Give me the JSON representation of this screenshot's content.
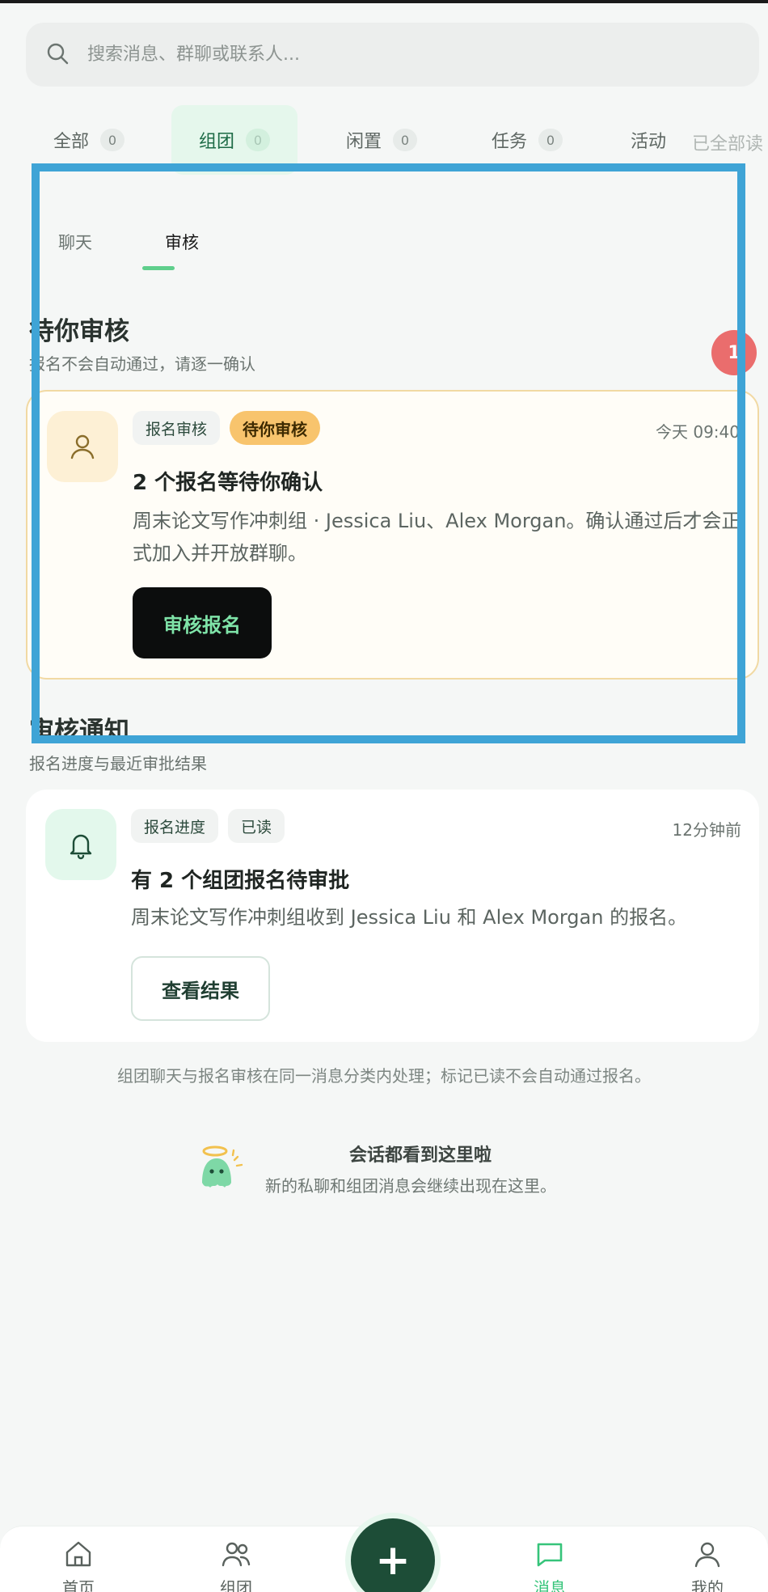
{
  "search": {
    "placeholder": "搜索消息、群聊或联系人..."
  },
  "category_tabs": [
    {
      "label": "全部",
      "count": "0"
    },
    {
      "label": "组团",
      "count": "0"
    },
    {
      "label": "闲置",
      "count": "0"
    },
    {
      "label": "任务",
      "count": "0"
    },
    {
      "label": "活动"
    }
  ],
  "mark_all_read": "已全部读",
  "sub_tabs": [
    {
      "label": "聊天"
    },
    {
      "label": "审核"
    }
  ],
  "float_badge": "1",
  "pending_section": {
    "title": "待你审核",
    "subtitle": "报名不会自动通过，请逐一确认",
    "card": {
      "tags": [
        "报名审核",
        "待你审核"
      ],
      "time": "今天 09:40",
      "title": "2 个报名等待你确认",
      "description": "周末论文写作冲刺组 · Jessica Liu、Alex Morgan。确认通过后才会正式加入并开放群聊。",
      "button": "审核报名"
    }
  },
  "notice_section": {
    "title": "审核通知",
    "subtitle": "报名进度与最近审批结果",
    "card": {
      "tags": [
        "报名进度",
        "已读"
      ],
      "time": "12分钟前",
      "title": "有 2 个组团报名待审批",
      "description": "周末论文写作冲刺组收到 Jessica Liu 和 Alex Morgan 的报名。",
      "button": "查看结果"
    }
  },
  "footnote": "组团聊天与报名审核在同一消息分类内处理；标记已读不会自动通过报名。",
  "end_state": {
    "title": "会话都看到这里啦",
    "subtitle": "新的私聊和组团消息会继续出现在这里。"
  },
  "bottom_nav": [
    {
      "label": "首页",
      "icon": "home-icon"
    },
    {
      "label": "组团",
      "icon": "group-icon"
    },
    {
      "label": "+",
      "icon": "plus-icon"
    },
    {
      "label": "消息",
      "icon": "message-icon"
    },
    {
      "label": "我的",
      "icon": "profile-icon"
    }
  ],
  "colors": {
    "accent": "#36c47a",
    "dark_green": "#1d4d37",
    "pending_tag": "#f8c46d",
    "badge_red": "#ea6d6d",
    "annotation_blue": "#3fa4d6"
  }
}
